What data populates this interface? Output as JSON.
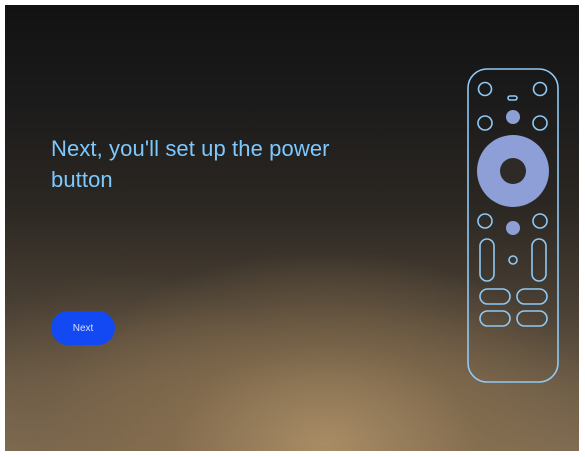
{
  "setup": {
    "title": "Next, you'll set up the power button",
    "next_label": "Next"
  },
  "remote_illustration": {
    "icon": "tv-remote-illustration",
    "outline_color": "#8fc9f5",
    "fill_color": "#8d9fd6"
  },
  "colors": {
    "title_text": "#7cc8ff",
    "button_background": "#1249f2",
    "button_text": "#d6e2ff"
  }
}
